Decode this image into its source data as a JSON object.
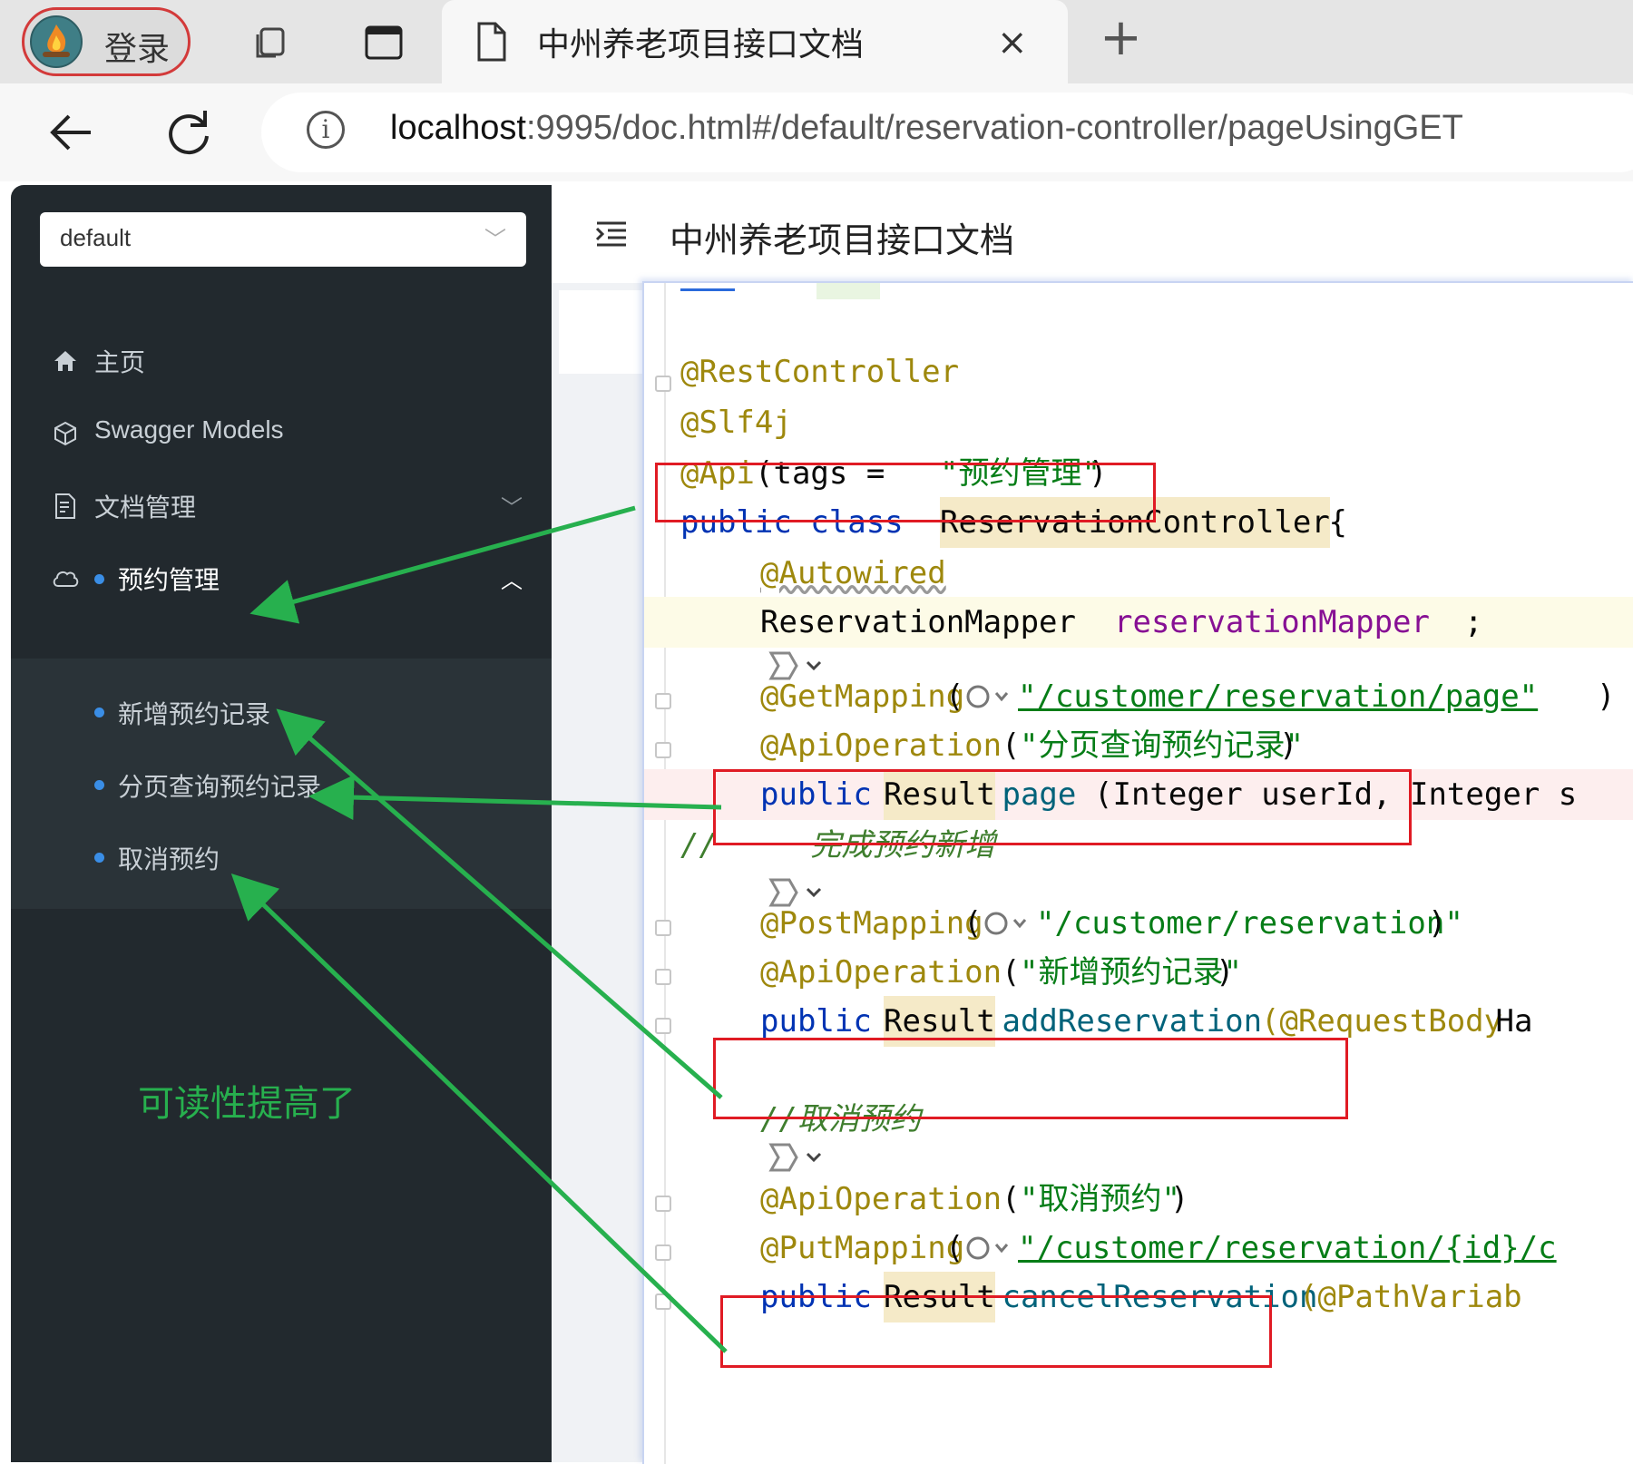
{
  "browser": {
    "profile_label": "登录",
    "tab_title": "中州养老项目接口文档",
    "close_glyph": "×",
    "new_tab_glyph": "+",
    "url_host": "localhost",
    "url_rest": ":9995/doc.html#/default/reservation-controller/pageUsingGET"
  },
  "sidebar": {
    "group_value": "default",
    "items": [
      {
        "label": "主页",
        "icon": "home-icon"
      },
      {
        "label": "Swagger Models",
        "icon": "cube-icon"
      },
      {
        "label": "文档管理",
        "icon": "document-icon"
      },
      {
        "label": "预约管理",
        "icon": "api-cloud-icon"
      }
    ],
    "sub_items": [
      "新增预约记录",
      "分页查询预约记录",
      "取消预约"
    ]
  },
  "main": {
    "title": "中州养老项目接口文档"
  },
  "code": {
    "lines": [
      {
        "anno": "@RestController"
      },
      {
        "anno": "@Slf4j"
      },
      {
        "anno": "@Api",
        "rest": "(tags = ",
        "str": "\"预约管理\"",
        "end": ")"
      },
      {
        "kw": "public class ",
        "cls": "ReservationController",
        "end": " {"
      },
      {
        "anno": "@Autowired"
      },
      {
        "type": "ReservationMapper ",
        "fld": "reservationMapper",
        "end": ";"
      },
      {
        "anno": "@GetMapping",
        "open": "(",
        "str": "\"/customer/reservation/page\"",
        "end": ")"
      },
      {
        "anno": "@ApiOperation",
        "open": "(",
        "str": "\"分页查询预约记录\"",
        "end": ")"
      },
      {
        "kw": "public ",
        "cls": "Result",
        "mth": " page",
        "end": "(Integer userId, Integer s"
      },
      {
        "cmt": "//     完成预约新增"
      },
      {
        "anno": "@PostMapping",
        "open": "(",
        "str": "\"/customer/reservation\"",
        "end": ")"
      },
      {
        "anno": "@ApiOperation",
        "open": "(",
        "str": "\"新增预约记录\"",
        "end": ")"
      },
      {
        "kw": "public ",
        "cls": "Result",
        "mth": " addReservation",
        "anno2": "(@RequestBody",
        "end": " Ha"
      },
      {
        "cmt": "//取消预约"
      },
      {
        "anno": "@ApiOperation",
        "open": "(",
        "str": "\"取消预约\"",
        "end": ")"
      },
      {
        "anno": "@PutMapping",
        "open": "(",
        "str": "\"/customer/reservation/{id}/c",
        "end": ""
      },
      {
        "kw": "public ",
        "cls": "Result",
        "mth": " cancelReservation",
        "anno2": "(@PathVariab",
        "end": ""
      }
    ]
  },
  "annotation_text": "可读性提高了",
  "colors": {
    "sidebar_bg": "#22292e",
    "accent_blue": "#3a8ee6",
    "highlight_red": "#e01b24",
    "arrow_green": "#27b04e"
  }
}
